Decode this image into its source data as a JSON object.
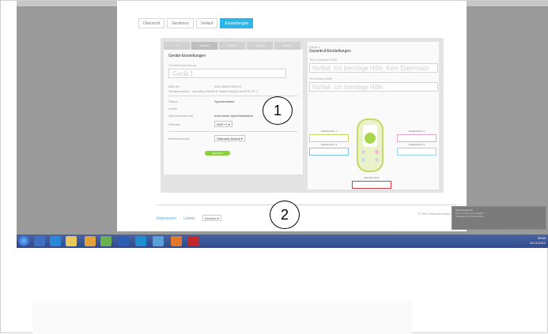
{
  "top_link": "",
  "tabs": [
    "Übersicht",
    "Geofence",
    "Verlauf",
    "Einstellungen"
  ],
  "device_tabs": [
    "+++",
    "Gerät 1",
    "Gerät 2",
    "Gerät 3",
    "Gerät 4",
    "Gerät 5"
  ],
  "left": {
    "section_title": "Geräte-Einstellungen",
    "name_label": "Gerätebezeichnung",
    "name_value": "Gerät 1",
    "imei_label": "IMEI-Nr.",
    "imei_value": "35117805270949/1",
    "device_label": "Gerätenummer",
    "device_value": "simvalley MOBILE Notruf Handy mit GPS RT-7",
    "status_label": "Status",
    "status_value": "Synchronisiert",
    "last_label": "Letzte",
    "sync_label": "Synchronisierung",
    "sync_value": "noch keine Synchronisation",
    "zone_label": "Zeitzone",
    "zone_value": "GMT+1",
    "mode_label": "Betriebsmodus",
    "mode_value": "Standard-Modus",
    "save_label": "Speichern"
  },
  "right": {
    "head_small": "Gerät 1",
    "title": "Garantruf-Einstellungen",
    "sms_label": "Text Garantruf-SMS",
    "sms_placeholder": "Notfall. Ich benötige Hilfe. Kein Datensatz",
    "sos_label": "Text Notruf-SMS",
    "sos_placeholder": "Notfall. Ich benötige Hilfe.",
    "key1": "Garantruf-Nr. 1",
    "key2": "Garantruf-Nr. 2",
    "key3": "Garantruf-Nr. 3",
    "key4": "Garantruf-Nr. 4",
    "sos_key": "Notrufnummer"
  },
  "footer": {
    "impressum": "Impressum",
    "lizenz": "Lizenz",
    "language": "Deutsch",
    "copyright": "© 2012 www.simvalley.de"
  },
  "callouts": [
    "1",
    "2"
  ],
  "tray": {
    "time": "09:59",
    "date": "18.12.2012"
  },
  "notification": {
    "title": "Dienstprogramm",
    "line1": "Neue Version ist verfügbar",
    "line2": "Installation wird vorbereitet"
  }
}
